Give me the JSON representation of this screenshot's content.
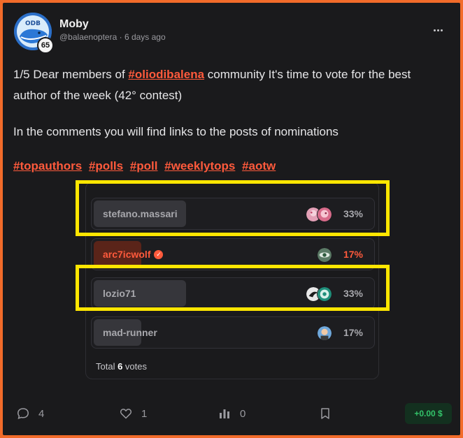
{
  "author": {
    "name": "Moby",
    "handle": "@balaenoptera",
    "time": "6 days ago",
    "meta_separator": "·",
    "level": "65",
    "avatar_text": "ODB"
  },
  "post": {
    "line1_prefix": "1/5 Dear members of ",
    "line1_link": "#oliodibalena",
    "line1_suffix": " community It's time to vote for the best author of the week (42° contest)",
    "line2": "In the comments you will find links to the posts of nominations",
    "tags": [
      "#topauthors",
      "#polls",
      "#poll",
      "#weeklytops",
      "#aotw"
    ]
  },
  "poll": {
    "options": [
      {
        "label": "stefano.massari",
        "percent": "33%",
        "fraction": 0.33,
        "voters": [
          "avatar-pink-1",
          "avatar-pink-2"
        ],
        "highlight": false
      },
      {
        "label": "arc7icwolf",
        "percent": "17%",
        "fraction": 0.17,
        "voters": [
          "avatar-eye"
        ],
        "highlight": true,
        "verified": true
      },
      {
        "label": "lozio71",
        "percent": "33%",
        "fraction": 0.33,
        "voters": [
          "avatar-eagle",
          "avatar-teal"
        ],
        "highlight": false
      },
      {
        "label": "mad-runner",
        "percent": "17%",
        "fraction": 0.17,
        "voters": [
          "avatar-man"
        ],
        "highlight": false
      }
    ],
    "total_prefix": "Total ",
    "total_count": "6",
    "total_suffix": " votes"
  },
  "footer": {
    "comments": "4",
    "likes": "1",
    "reblogs": "0",
    "earnings": "+0.00 $"
  },
  "colors": {
    "accent": "#ff5a3c",
    "highlight_box": "#ffe600",
    "frame": "#f26b2a",
    "earnings_green": "#33c46a"
  },
  "icons": [
    "comment-icon",
    "heart-icon",
    "stats-icon",
    "bookmark-icon",
    "more-icon",
    "verified-icon"
  ]
}
